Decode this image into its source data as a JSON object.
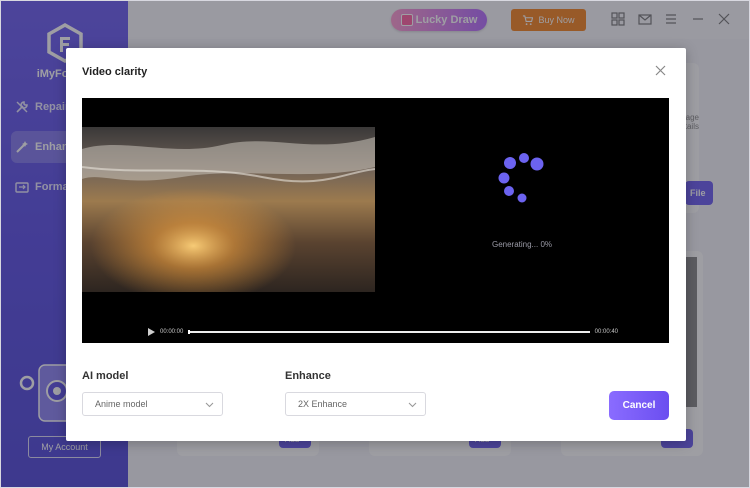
{
  "app": {
    "brand": "iMyFone U",
    "nav": [
      {
        "label": "Repair",
        "icon": "wrench-icon"
      },
      {
        "label": "Enhanc",
        "icon": "magic-wand-icon",
        "active": true
      },
      {
        "label": "Format",
        "icon": "convert-icon"
      }
    ],
    "account_label": "My Account",
    "lucky_draw": "Lucky Draw",
    "buy_now": "Buy Now",
    "bg_right_text_1": "nage",
    "bg_right_text_2": "etails",
    "bg_file_button": "File",
    "bg_add_button": "Add"
  },
  "modal": {
    "title": "Video clarity",
    "generating_text": "Generating... 0%",
    "time_current": "00:00:00",
    "time_total": "00:00:40",
    "progress": 0.0,
    "ai_model_label": "AI model",
    "ai_model_value": "Anime model",
    "enhance_label": "Enhance",
    "enhance_value": "2X Enhance",
    "cancel_label": "Cancel"
  },
  "colors": {
    "accent": "#6b5cf0",
    "buy_now": "#f5831f",
    "spinner": "#6c63f0"
  }
}
